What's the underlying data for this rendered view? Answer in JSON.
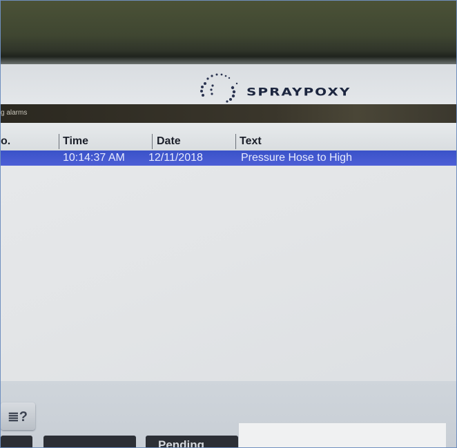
{
  "brand": {
    "logo_text": "SPRAYPOXY"
  },
  "window": {
    "title": "g alarms"
  },
  "table": {
    "columns": [
      "o.",
      "Time",
      "Date",
      "Text"
    ],
    "rows": [
      {
        "no": "",
        "time": "10:14:37 AM",
        "date": "12/11/2018",
        "text": "Pressure Hose to High"
      }
    ]
  },
  "toolbar": {
    "help_icon_glyph": "≣?",
    "pending_label": "Pending"
  },
  "colors": {
    "selection": "#3f55cc",
    "titlebar": "#2f2c24"
  }
}
